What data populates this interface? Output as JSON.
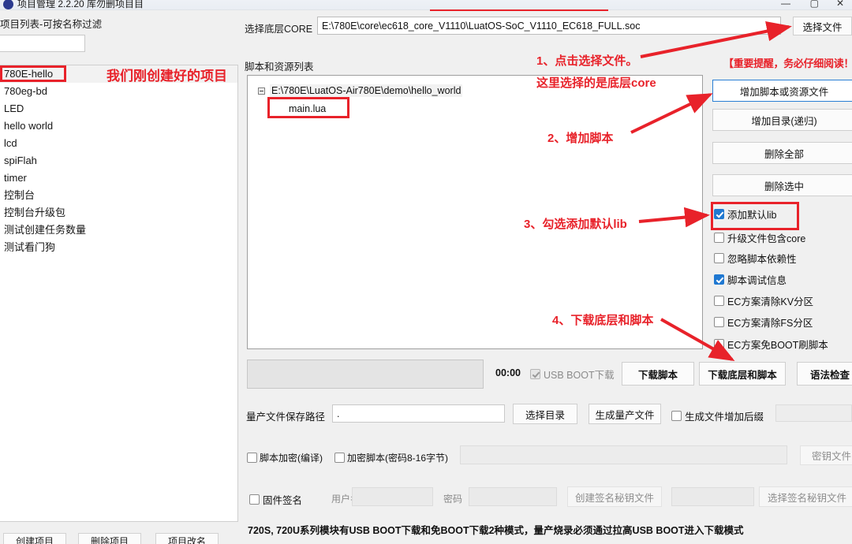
{
  "window": {
    "title": "项目管理 2.2.20 库勿删项目目",
    "minimize": "—",
    "maximize": "▢",
    "close": "✕"
  },
  "left": {
    "list_label": "项目列表-可按名称过滤",
    "filter_value": "",
    "filter_placeholder": "",
    "projects": [
      "780E-hello",
      "780eg-bd",
      "LED",
      "hello world",
      "lcd",
      "spiFlah",
      "timer",
      "控制台",
      "控制台升级包",
      "测试创建任务数量",
      "测试看门狗"
    ],
    "selected_project": "780E-hello",
    "buttons": [
      "创建项目",
      "删除项目",
      "项目改名"
    ]
  },
  "core": {
    "label": "选择底层CORE",
    "path": "E:\\780E\\core\\ec618_core_V1110\\LuatOS-SoC_V1110_EC618_FULL.soc",
    "select_file_button": "选择文件"
  },
  "tree": {
    "label": "脚本和资源列表",
    "root": "E:\\780E\\LuatOS-Air780E\\demo\\hello_world",
    "children": [
      "main.lua"
    ]
  },
  "right": {
    "warning": "【重要提醒，务必仔细阅读！",
    "buttons": [
      "增加脚本或资源文件",
      "增加目录(递归)",
      "删除全部",
      "删除选中"
    ],
    "checkboxes": [
      {
        "label": "添加默认lib",
        "checked": true,
        "disabled": false
      },
      {
        "label": "升级文件包含core",
        "checked": false,
        "disabled": false
      },
      {
        "label": "忽略脚本依赖性",
        "checked": false,
        "disabled": false
      },
      {
        "label": "脚本调试信息",
        "checked": true,
        "disabled": false
      },
      {
        "label": "EC方案清除KV分区",
        "checked": false,
        "disabled": false
      },
      {
        "label": "EC方案清除FS分区",
        "checked": false,
        "disabled": false
      },
      {
        "label": "EC方案免BOOT刷脚本",
        "checked": false,
        "disabled": false
      }
    ]
  },
  "download": {
    "timer": "00:00",
    "usb_boot_label": "USB BOOT下载",
    "usb_boot_checked": true,
    "buttons": [
      "下载脚本",
      "下载底层和脚本",
      "语法检查"
    ]
  },
  "massprod": {
    "label": "量产文件保存路径",
    "path_value": ".",
    "select_dir_button": "选择目录",
    "generate_button": "生成量产文件",
    "suffix_checkbox": "生成文件增加后缀",
    "suffix_checked": false,
    "suffix_value": ""
  },
  "encrypt": {
    "check1": "脚本加密(编译)",
    "check1_checked": false,
    "check2": "加密脚本(密码8-16字节)",
    "check2_checked": false,
    "password_value": "",
    "key_file_button": "密钥文件"
  },
  "signature": {
    "check": "固件签名",
    "check_checked": false,
    "username_label": "用户名",
    "username_value": "",
    "password_label": "密码",
    "password_value": "",
    "create_key_button": "创建签名秘钥文件",
    "key_path_value": "",
    "select_key_button": "选择签名秘钥文件"
  },
  "footer": {
    "note": "720S, 720U系列模块有USB BOOT下载和免BOOT下载2种模式，量产烧录必须通过拉高USB BOOT进入下载模式"
  },
  "annotations": {
    "project_note": "我们刚创建好的项目",
    "step1": "1、点击选择文件。",
    "step1b": "这里选择的是底层core",
    "step2": "2、增加脚本",
    "step3": "3、勾选添加默认lib",
    "step4": "4、下载底层和脚本",
    "accent_color": "#e8222a"
  }
}
